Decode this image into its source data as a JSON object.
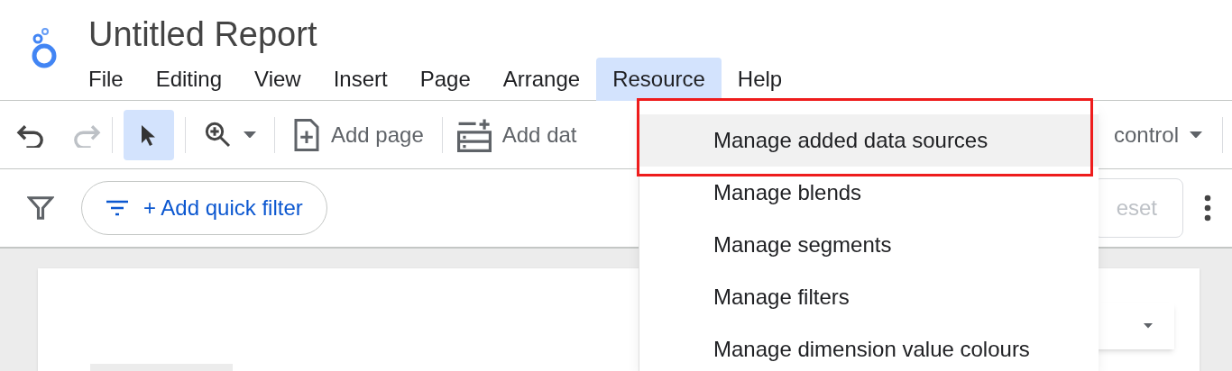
{
  "app": {
    "title": "Untitled Report"
  },
  "menubar": [
    {
      "label": "File",
      "selected": false
    },
    {
      "label": "Editing",
      "selected": false
    },
    {
      "label": "View",
      "selected": false
    },
    {
      "label": "Insert",
      "selected": false
    },
    {
      "label": "Page",
      "selected": false
    },
    {
      "label": "Arrange",
      "selected": false
    },
    {
      "label": "Resource",
      "selected": true
    },
    {
      "label": "Help",
      "selected": false
    }
  ],
  "toolbar": {
    "undo": {
      "disabled": false
    },
    "redo": {
      "disabled": true
    },
    "select": {
      "selected": true
    },
    "add_page": "Add page",
    "add_data": "Add dat",
    "control": "control"
  },
  "filter_bar": {
    "quick_filter": "+ Add quick filter",
    "reset": "eset"
  },
  "dropdown": [
    {
      "label": "Manage added data sources",
      "selected": true,
      "outlined": true
    },
    {
      "label": "Manage blends",
      "selected": false,
      "outlined": false
    },
    {
      "label": "Manage segments",
      "selected": false,
      "outlined": false
    },
    {
      "label": "Manage filters",
      "selected": false,
      "outlined": false
    },
    {
      "label": "Manage dimension value colours",
      "selected": false,
      "outlined": false
    }
  ]
}
